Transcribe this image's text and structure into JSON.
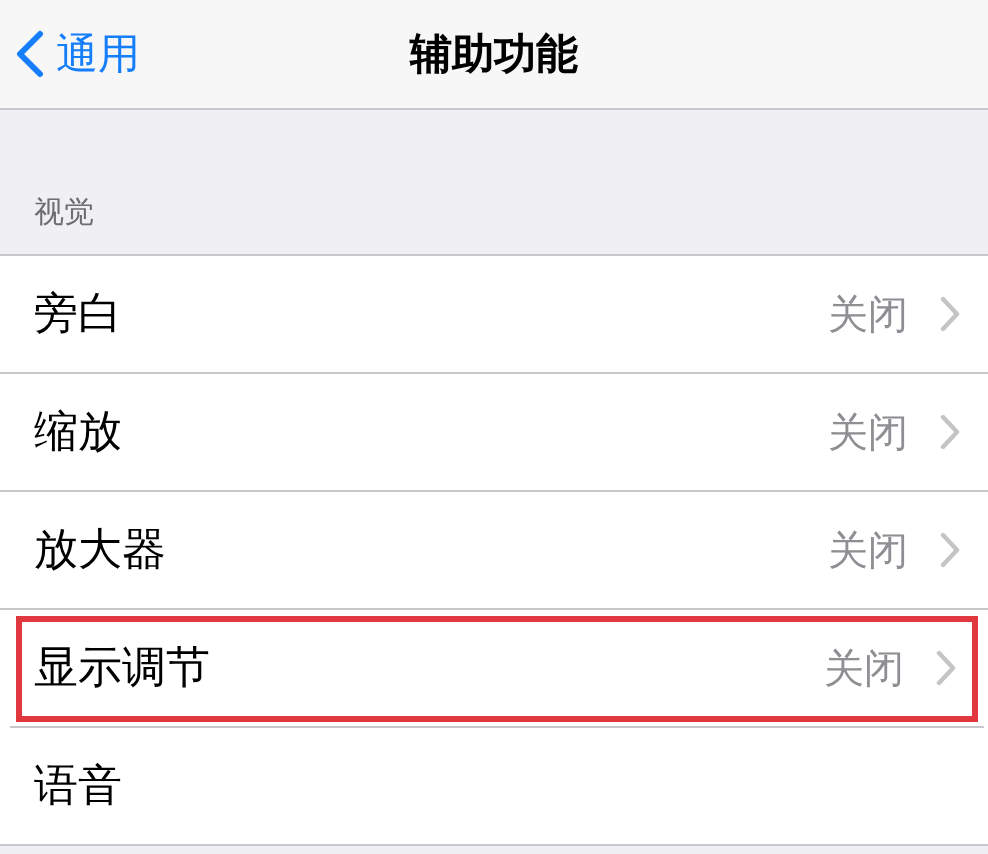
{
  "nav": {
    "back": "通用",
    "title": "辅助功能"
  },
  "section": {
    "header": "视觉"
  },
  "rows": [
    {
      "label": "旁白",
      "value": "关闭",
      "highlighted": false
    },
    {
      "label": "缩放",
      "value": "关闭",
      "highlighted": false
    },
    {
      "label": "放大器",
      "value": "关闭",
      "highlighted": false
    },
    {
      "label": "显示调节",
      "value": "关闭",
      "highlighted": true
    },
    {
      "label": "语音",
      "highlighted": false
    }
  ]
}
